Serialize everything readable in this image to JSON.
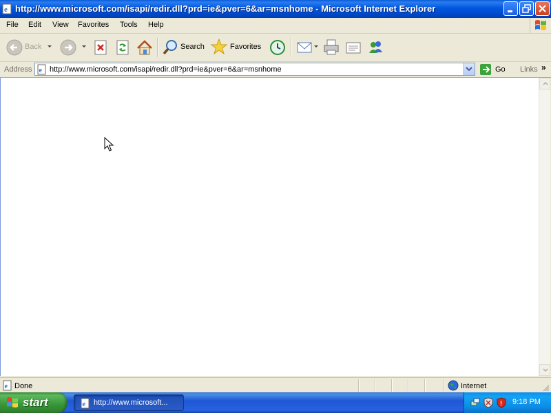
{
  "window": {
    "title": "http://www.microsoft.com/isapi/redir.dll?prd=ie&pver=6&ar=msnhome - Microsoft Internet Explorer"
  },
  "menu": [
    "File",
    "Edit",
    "View",
    "Favorites",
    "Tools",
    "Help"
  ],
  "toolbar": {
    "back_label": "Back",
    "search_label": "Search",
    "favorites_label": "Favorites"
  },
  "address": {
    "label": "Address",
    "url": "http://www.microsoft.com/isapi/redir.dll?prd=ie&pver=6&ar=msnhome",
    "go_label": "Go",
    "links_label": "Links",
    "links_chevron": "»"
  },
  "status": {
    "text": "Done",
    "zone": "Internet"
  },
  "taskbar": {
    "start_label": "start",
    "task_label": "http://www.microsoft...",
    "clock": "9:18 PM"
  },
  "icons": {
    "ie_icon": "ie-page-icon",
    "back_icon": "back-arrow-icon",
    "forward_icon": "forward-arrow-icon",
    "stop_icon": "stop-icon",
    "refresh_icon": "refresh-icon",
    "home_icon": "home-icon",
    "search_icon": "magnifier-icon",
    "favorites_icon": "star-icon",
    "history_icon": "history-icon",
    "mail_icon": "mail-icon",
    "print_icon": "printer-icon",
    "edit_icon": "edit-icon",
    "messenger_icon": "messenger-icon"
  },
  "colors": {
    "titlebar": "#0058e0",
    "taskbar": "#2157d7",
    "start": "#379537",
    "tray": "#0f8bef"
  }
}
